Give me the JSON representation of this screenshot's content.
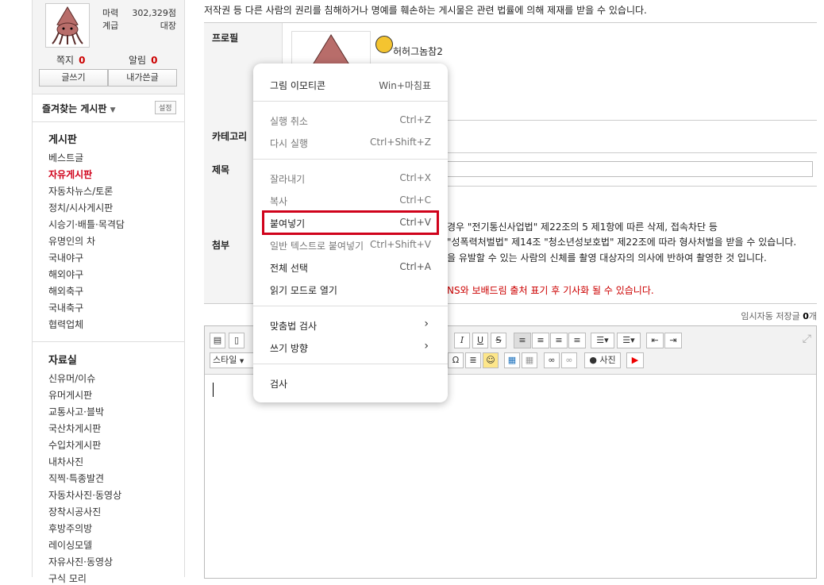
{
  "sidebar": {
    "stats": [
      {
        "label": "마력",
        "value": "302,329점"
      },
      {
        "label": "계급",
        "value": "대장"
      }
    ],
    "messages": [
      {
        "label": "쪽지",
        "count": "0"
      },
      {
        "label": "알림",
        "count": "0"
      }
    ],
    "buttons": {
      "write": "글쓰기",
      "my_posts": "내가쓴글"
    },
    "favorites": {
      "label": "즐겨찾는 게시판",
      "settings": "설정"
    },
    "board": {
      "title": "게시판",
      "items": [
        "베스트글",
        "자유게시판",
        "자동차뉴스/토론",
        "정치/시사게시판",
        "시승기·배틀·목격담",
        "유명인의 차",
        "국내야구",
        "해외야구",
        "해외축구",
        "국내축구",
        "협력업체"
      ]
    },
    "archive": {
      "title": "자료실",
      "items": [
        "신유머/이슈",
        "유머게시판",
        "교통사고·블박",
        "국산차게시판",
        "수입차게시판",
        "내차사진",
        "직찍·특종발견",
        "자동차사진·동영상",
        "장착시공사진",
        "후방주의방",
        "레이싱모델",
        "자유사진·동영상",
        "구식 모리"
      ]
    }
  },
  "main": {
    "notice": "저작권 등 다른 사람의 권리를 침해하거나 명예를 훼손하는 게시물은 관련 법률에 의해 제재를 받을 수 있습니다.",
    "labels": {
      "profile": "프로필",
      "category": "카테고리",
      "title": "제목",
      "attach": "첨부"
    },
    "nickname": "허허그놈참2",
    "attach_lines": [
      "경우 \"전기통신사업법\" 제22조의 5 제1항에 따른 삭제, 접속차단 등",
      "\"성폭력처벌법\" 제14조 \"청소년성보호법\" 제22조에 따라 형사처벌을 받을 수 있습니다.",
      "을 유발할 수 있는 사람의 신체를 촬영 대상자의 의사에 반하여 촬영한 것 입니다."
    ],
    "attach_red": "NS와 보배드림 출처 표기 후 기사화 될 수 있습니다.",
    "temp_save": {
      "label": "임시자동 저장글",
      "count": "0",
      "unit": "개"
    },
    "toolbar": {
      "style": "스타일",
      "photo": "사진"
    }
  },
  "context_menu": {
    "items": [
      {
        "label": "그림 이모티콘",
        "shortcut": "Win+마침표",
        "disabled": false
      },
      {
        "label": "실행 취소",
        "shortcut": "Ctrl+Z",
        "disabled": true
      },
      {
        "label": "다시 실행",
        "shortcut": "Ctrl+Shift+Z",
        "disabled": true
      },
      {
        "label": "잘라내기",
        "shortcut": "Ctrl+X",
        "disabled": true
      },
      {
        "label": "복사",
        "shortcut": "Ctrl+C",
        "disabled": true
      },
      {
        "label": "붙여넣기",
        "shortcut": "Ctrl+V",
        "disabled": false
      },
      {
        "label": "일반 텍스트로 붙여넣기",
        "shortcut": "Ctrl+Shift+V",
        "disabled": true
      },
      {
        "label": "전체 선택",
        "shortcut": "Ctrl+A",
        "disabled": false
      },
      {
        "label": "읽기 모드로 열기",
        "shortcut": "",
        "disabled": false
      },
      {
        "label": "맞춤법 검사",
        "shortcut": "",
        "disabled": false
      },
      {
        "label": "쓰기 방향",
        "shortcut": "",
        "disabled": false
      },
      {
        "label": "검사",
        "shortcut": "",
        "disabled": false
      }
    ],
    "highlighted": "붙여넣기",
    "highlight_color": "#d0021b"
  }
}
